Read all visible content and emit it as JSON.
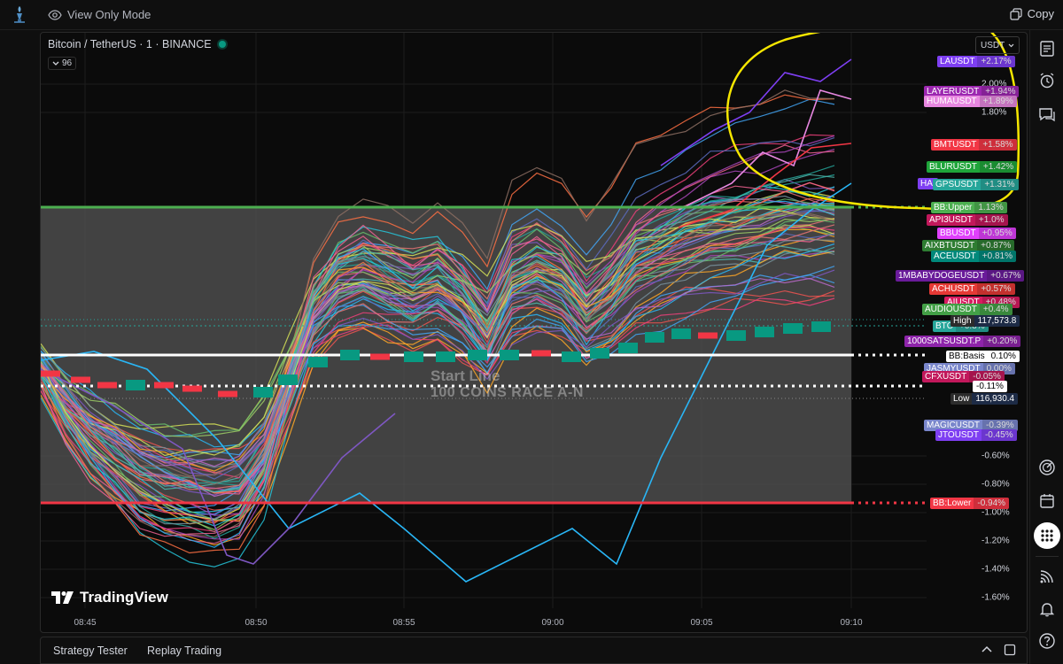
{
  "topbar": {
    "view_only_label": "View Only Mode",
    "copy_label": "Copy"
  },
  "chart": {
    "title": "Bitcoin / TetherUS · 1 · BINANCE",
    "indicator_count": "96",
    "currency": "USDT",
    "watermark_line1": "Start Line",
    "watermark_line2": "100 COINS RACE A-N",
    "brand": "TradingView",
    "colors": {
      "bb_upper": "#4caf50",
      "bb_lower": "#f23645",
      "bb_basis": "#ffffff",
      "annotation": "#f5e600",
      "band_fill": "#555555",
      "up_candle": "#089981",
      "down_candle": "#f23645"
    },
    "x_ticks": [
      "08:45",
      "08:50",
      "08:55",
      "09:00",
      "09:05",
      "09:10"
    ],
    "y_ticks": [
      "2.00%",
      "1.80%",
      "-0.60%",
      "-0.80%",
      "-1.00%",
      "-1.20%",
      "-1.40%",
      "-1.60%"
    ],
    "labels": [
      {
        "name": "LAUSDT",
        "pct": "+2.17%",
        "color": "#7e3ff2"
      },
      {
        "name": "LAYERUSDT",
        "pct": "+1.94%",
        "color": "#9c27b0"
      },
      {
        "name": "HUMAUSDT",
        "pct": "+1.89%",
        "color": "#e787e0"
      },
      {
        "name": "BMTUSDT",
        "pct": "+1.58%",
        "color": "#f23645"
      },
      {
        "name": "BLURUSDT",
        "pct": "+1.42%",
        "color": "#1fa53a"
      },
      {
        "name": "HAI",
        "pct": "",
        "color": "#7e3ff2"
      },
      {
        "name": "GPSUSDT",
        "pct": "+1.31%",
        "color": "#26a69a"
      },
      {
        "name": "BB:Upper",
        "pct": "1.13%",
        "color": "#4caf50"
      },
      {
        "name": "API3USDT",
        "pct": "+1.0%",
        "color": "#c2185b"
      },
      {
        "name": "BBUSDT",
        "pct": "+0.95%",
        "color": "#e040fb"
      },
      {
        "name": "AIXBTUSDT",
        "pct": "+0.87%",
        "color": "#2e7d32"
      },
      {
        "name": "ACEUSDT",
        "pct": "+0.81%",
        "color": "#00897b"
      },
      {
        "name": "1MBABYDOGEUSDT",
        "pct": "+0.67%",
        "color": "#6a1b9a"
      },
      {
        "name": "ACHUSDT",
        "pct": "+0.57%",
        "color": "#e53935"
      },
      {
        "name": "AIUSDT",
        "pct": "+0.48%",
        "color": "#d81b60"
      },
      {
        "name": "AUDIOUSDT",
        "pct": "+0.4%",
        "color": "#43a047"
      },
      {
        "name": "BTC",
        "pct": "+0.3%",
        "color": "#26a69a"
      },
      {
        "name": "1000SATSUSDT.P",
        "pct": "+0.20%",
        "color": "#8e24aa"
      },
      {
        "name": "BB:Basis",
        "pct": "0.10%",
        "color": "#ffffff"
      },
      {
        "name": "JASMYUSDT",
        "pct": "0.00%",
        "color": "#7986cb"
      },
      {
        "name": "CFXUSDT",
        "pct": "-0.05%",
        "color": "#c2185b"
      },
      {
        "name": "",
        "pct": "-0.11%",
        "color": "#ffffff"
      },
      {
        "name": "MAGICUSDT",
        "pct": "-0.39%",
        "color": "#7986cb"
      },
      {
        "name": "JTOUSDT",
        "pct": "-0.45%",
        "color": "#7e3ff2"
      },
      {
        "name": "BB:Lower",
        "pct": "-0.94%",
        "color": "#f23645"
      }
    ],
    "high_label": "High",
    "high_value": "117,573.8",
    "low_label": "Low",
    "low_value": "116,930.4"
  },
  "bottom": {
    "tab1": "Strategy Tester",
    "tab2": "Replay Trading"
  },
  "sidebar": {
    "icons": [
      "watchlist-icon",
      "alarm-icon",
      "chat-icon",
      "target-icon",
      "calendar-icon",
      "apps-icon",
      "signal-icon",
      "bell-icon",
      "help-icon"
    ]
  }
}
